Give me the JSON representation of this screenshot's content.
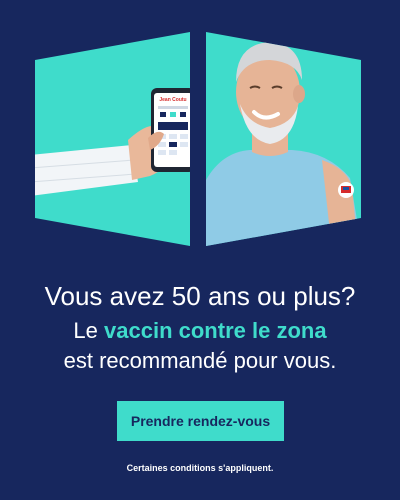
{
  "brand": {
    "name": "Jean Coutu",
    "colors": {
      "background": "#17275e",
      "accent": "#3fdccb",
      "text": "#ffffff"
    }
  },
  "headline": "Vous avez 50 ans ou plus?",
  "subline": {
    "prefix": "Le",
    "highlight": "vaccin contre le zona",
    "suffix": "est recommandé pour vous."
  },
  "cta": {
    "label": "Prendre rendez-vous"
  },
  "disclaimer": "Certaines conditions s'appliquent.",
  "images": {
    "left": "hand-holding-phone-with-booking-app",
    "right": "smiling-senior-man-with-vaccine-bandage"
  },
  "icons": {
    "bandage": "jean-coutu-bandage-icon"
  }
}
